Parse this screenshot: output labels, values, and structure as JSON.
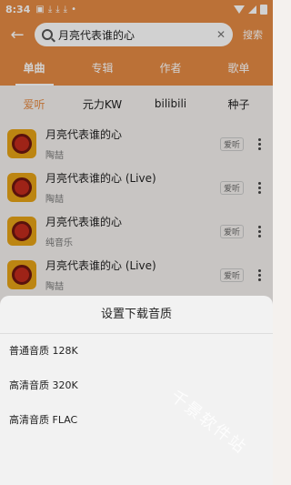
{
  "status_bar": {
    "time": "8:34",
    "notif_icons": [
      "image-icon",
      "download-icon",
      "download-icon",
      "download-icon",
      "dot-icon"
    ]
  },
  "header": {
    "search_value": "月亮代表谁的心",
    "search_button": "搜索"
  },
  "tabs": [
    {
      "label": "单曲",
      "active": true
    },
    {
      "label": "专辑"
    },
    {
      "label": "作者"
    },
    {
      "label": "歌单"
    }
  ],
  "sources": [
    {
      "label": "爱听",
      "active": true
    },
    {
      "label": "元力KW"
    },
    {
      "label": "bilibili"
    },
    {
      "label": "种子"
    }
  ],
  "songs": [
    {
      "title": "月亮代表谁的心",
      "artist": "陶喆",
      "badge": "爱听"
    },
    {
      "title": "月亮代表谁的心 (Live)",
      "artist": "陶喆",
      "badge": "爱听"
    },
    {
      "title": "月亮代表谁的心",
      "artist": "纯音乐",
      "badge": "爱听"
    },
    {
      "title": "月亮代表谁的心 (Live)",
      "artist": "陶喆",
      "badge": "爱听"
    }
  ],
  "sheet": {
    "title": "设置下载音质",
    "options": [
      "普通音质 128K",
      "高清音质 320K",
      "高清音质 FLAC"
    ]
  },
  "watermark": "千景软件站",
  "colors": {
    "accent": "#e58a44"
  }
}
